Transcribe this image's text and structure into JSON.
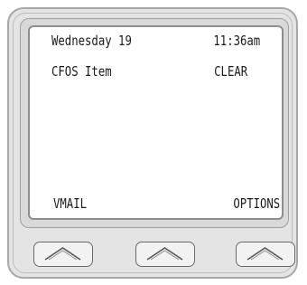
{
  "display": {
    "date": "Wednesday 19",
    "time": "11:36am",
    "line2_left": "CFOS Item",
    "line2_right": "CLEAR",
    "softkey_left_label": "VMAIL",
    "softkey_right_label": "OPTIONS"
  },
  "softkeys": [
    {
      "icon": "chevron-up-icon"
    },
    {
      "icon": "chevron-up-icon"
    },
    {
      "icon": "chevron-up-icon"
    }
  ],
  "colors": {
    "frame": "#e4e4e4",
    "frame_border": "#a8a8a8",
    "screen_bg": "#ffffff",
    "text": "#1a1a1a",
    "key_bg": "#f2f2f2",
    "key_border": "#6a6a6a"
  }
}
